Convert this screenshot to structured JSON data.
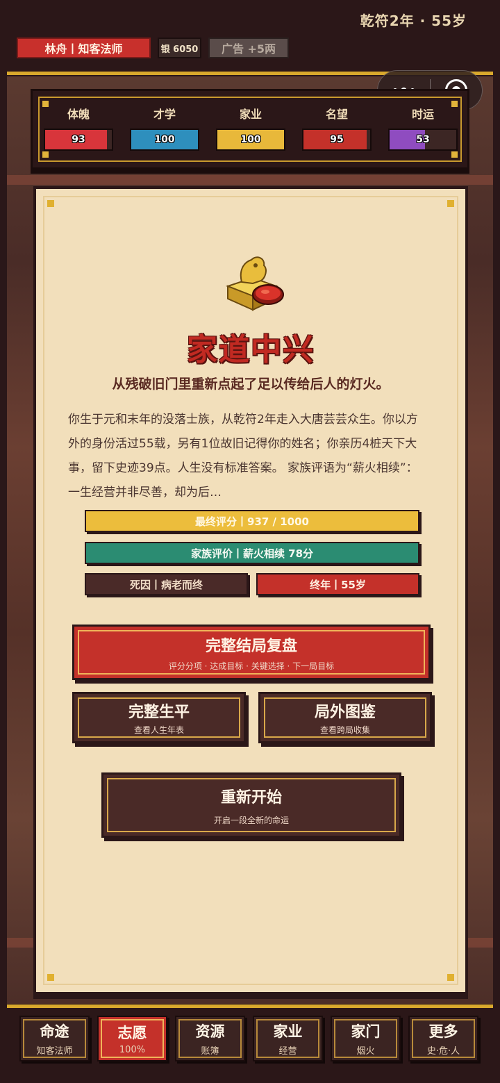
{
  "header": {
    "date_line": "乾符2年 · 55岁",
    "name_chip": "林舟丨知客法师",
    "silver_chip": "银 6050",
    "ad_chip": "广告 +5两"
  },
  "miniapp_capsule": {
    "more_icon": "more-dots-icon",
    "close_icon": "target-close-icon"
  },
  "stats": [
    {
      "label": "体魄",
      "value": "93",
      "fraction": 0.93,
      "color": "#d8353b"
    },
    {
      "label": "才学",
      "value": "100",
      "fraction": 1.0,
      "color": "#2e8fbd"
    },
    {
      "label": "家业",
      "value": "100",
      "fraction": 1.0,
      "color": "#e8b83a"
    },
    {
      "label": "名望",
      "value": "95",
      "fraction": 0.95,
      "color": "#c4312a"
    },
    {
      "label": "时运",
      "value": "53",
      "fraction": 0.53,
      "color": "#8f4cc0"
    }
  ],
  "result": {
    "icon": "jade-seal-icon",
    "title": "家道中兴",
    "subtitle": "从残破旧门里重新点起了足以传给后人的灯火。",
    "description": "你生于元和末年的没落士族，从乾符2年走入大唐芸芸众生。你以方外的身份活过55载，另有1位故旧记得你的姓名；你亲历4桩天下大事，留下史迹39点。人生没有标准答案。 家族评语为“薪火相续”：一生经营并非尽善，却为后…",
    "score_bar": "最终评分丨937 / 1000",
    "family_bar": "家族评价丨薪火相续 78分",
    "death_bar": "死因丨病老而终",
    "age_bar": "终年丨55岁"
  },
  "actions": {
    "review_title": "完整结局复盘",
    "review_sub": "评分分项 · 达成目标 · 关键选择 · 下一局目标",
    "life_title": "完整生平",
    "life_sub": "查看人生年表",
    "atlas_title": "局外图鉴",
    "atlas_sub": "查看跨局收集",
    "restart_title": "重新开始",
    "restart_sub": "开启一段全新的命运"
  },
  "nav": [
    {
      "title": "命途",
      "sub": "知客法师",
      "active": false
    },
    {
      "title": "志愿",
      "sub": "100%",
      "active": true
    },
    {
      "title": "资源",
      "sub": "账簿",
      "active": false
    },
    {
      "title": "家业",
      "sub": "经营",
      "active": false
    },
    {
      "title": "家门",
      "sub": "烟火",
      "active": false
    },
    {
      "title": "更多",
      "sub": "史·危·人",
      "active": false
    }
  ]
}
